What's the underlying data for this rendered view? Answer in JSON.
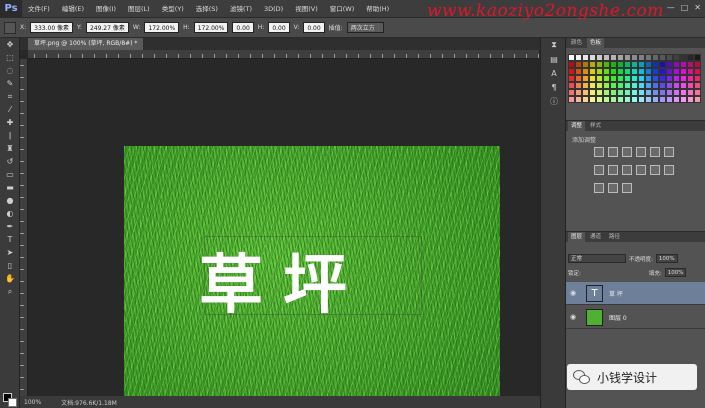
{
  "app": {
    "logo": "Ps"
  },
  "menu": [
    "文件(F)",
    "编辑(E)",
    "图像(I)",
    "图层(L)",
    "类型(Y)",
    "选择(S)",
    "滤镜(T)",
    "3D(D)",
    "视图(V)",
    "窗口(W)",
    "帮助(H)"
  ],
  "window_controls": [
    "—",
    "□",
    "✕"
  ],
  "options": {
    "x_label": "X:",
    "x_value": "333.00 像素",
    "y_label": "Y:",
    "y_value": "249.27 像素",
    "w_label": "W:",
    "w_value": "172.00%",
    "h_label": "H:",
    "h_value": "172.00%",
    "angle_value": "0.00",
    "hs_label": "H:",
    "hs_value": "0.00",
    "v_label": "V:",
    "v_value": "0.00",
    "interp_label": "插值:",
    "interp_value": "两次立方"
  },
  "watermark": "www.kaoziyo2ongshe.com",
  "document": {
    "tab_title": "草坪.png @ 100% (草坪, RGB/8#) *",
    "canvas_text": "草坪",
    "zoom": "100%",
    "doc_size": "文档:976.6K/1.18M"
  },
  "swatch_panel": {
    "tabs": [
      "颜色",
      "色板"
    ]
  },
  "adjustments_panel": {
    "tabs": [
      "调整",
      "样式"
    ],
    "title": "添加调整"
  },
  "layers_panel": {
    "tabs": [
      "图层",
      "通道",
      "路径"
    ],
    "blend_mode": "正常",
    "opacity_label": "不透明度:",
    "opacity_value": "100%",
    "lock_label": "锁定:",
    "fill_label": "填充:",
    "fill_value": "100%",
    "layers": [
      {
        "name": "草 坪",
        "thumb": "T",
        "selected": true
      },
      {
        "name": "图层 0",
        "thumb": "",
        "selected": false
      }
    ]
  },
  "wechat_badge": {
    "text": "小钱学设计"
  },
  "colors": {
    "accent_selection": "#6e7f99",
    "grass": "#3a9a26",
    "watermark": "#e0162b"
  }
}
